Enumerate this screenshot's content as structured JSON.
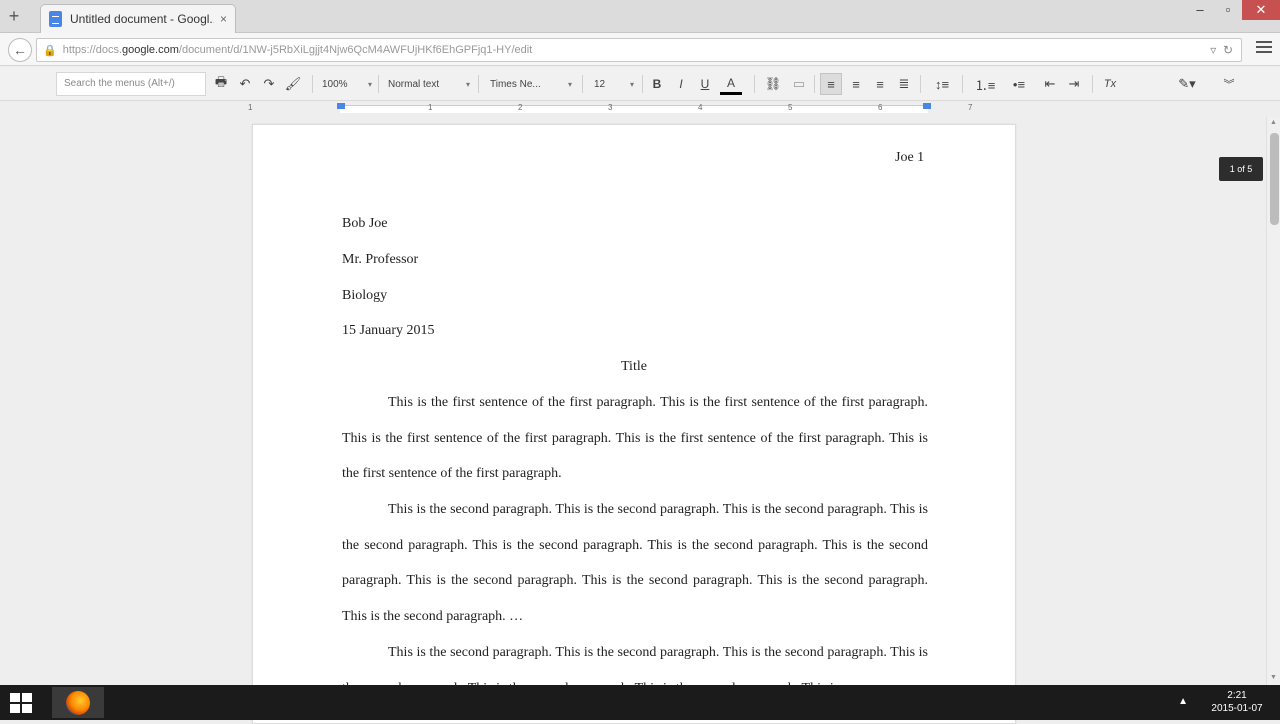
{
  "browser": {
    "new_tab": "+",
    "tab_title": "Untitled document - Googl...",
    "tab_close": "×",
    "window_controls": {
      "minimize": "–",
      "restore": "▫",
      "close": "✕"
    },
    "url_prefix": "https://docs.",
    "url_domain": "google.com",
    "url_path": "/document/d/1NW-j5RbXiLgjjt4Njw6QcM4AWFUjHKf6EhGPFjq1-HY/edit",
    "back": "←"
  },
  "toolbar": {
    "search_placeholder": "Search the menus (Alt+/)",
    "zoom": "100%",
    "style": "Normal text",
    "font": "Times Ne...",
    "size": "12",
    "bold": "B",
    "italic": "I",
    "underline": "U",
    "text_color": "A",
    "clear_formatting": "Tx"
  },
  "ruler": {
    "numbers": [
      "1",
      "1",
      "2",
      "3",
      "4",
      "5",
      "6",
      "7"
    ]
  },
  "document": {
    "header": "Joe 1",
    "lines": [
      "Bob Joe",
      "Mr. Professor",
      "Biology",
      "15 January 2015"
    ],
    "title": "Title",
    "paragraphs": [
      "This is the first sentence of the first paragraph. This is the first sentence of the first paragraph. This is the first sentence of the first paragraph. This is the first sentence of the first paragraph. This is the first sentence of the first paragraph.",
      "This is the second paragraph. This is the second paragraph. This is the second paragraph. This is the second paragraph. This is the second paragraph. This is the second paragraph. This is the second paragraph. This is the second paragraph. This is the second paragraph. This is the second paragraph. This is the second paragraph. …",
      "This is the second paragraph. This is the second paragraph. This is the second paragraph. This is the second paragraph. This is the second paragraph. This is the second paragraph. This is"
    ]
  },
  "scroll": {
    "page_indicator": "1 of 5"
  },
  "taskbar": {
    "tray_arrow": "▲",
    "time": "2:21",
    "date": "2015-01-07"
  },
  "colors": {
    "accent": "#4a86e8",
    "close_button": "#c75050",
    "taskbar": "#1b1b1b"
  }
}
